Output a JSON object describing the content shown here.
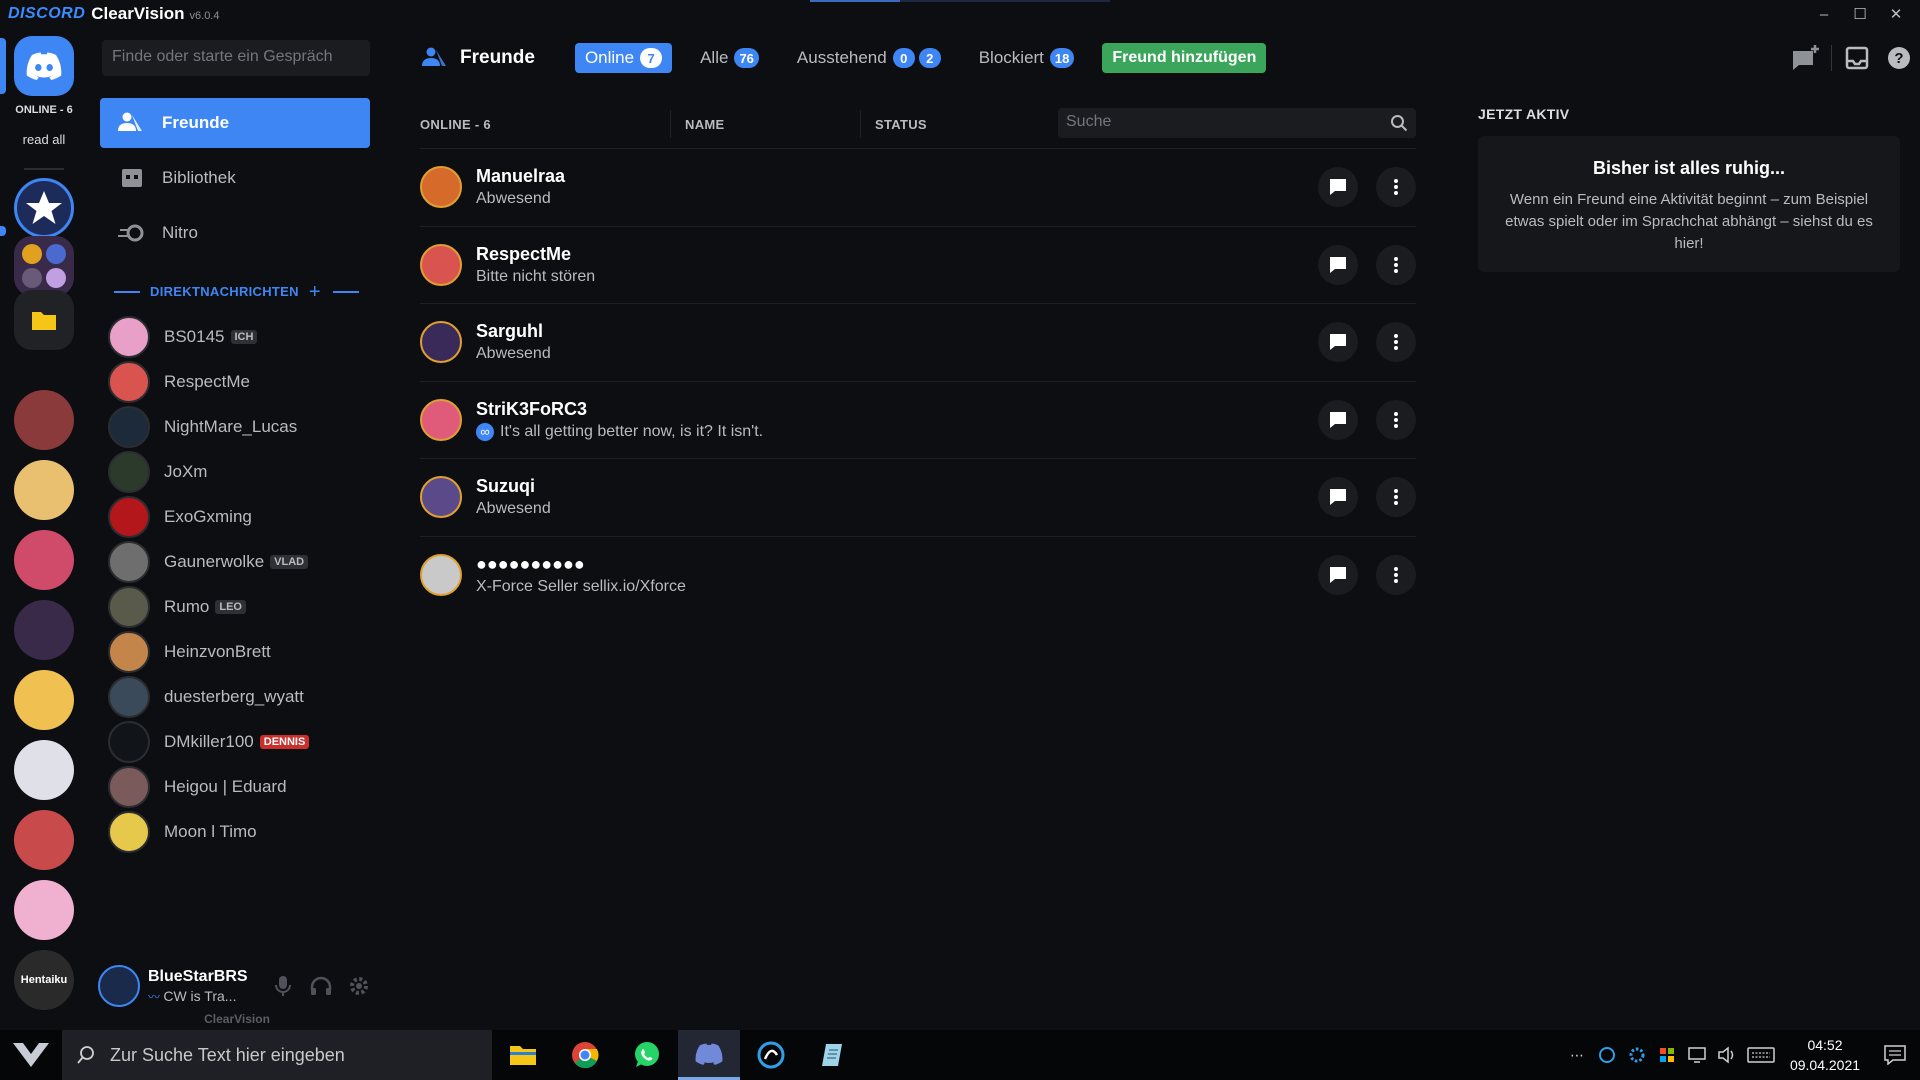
{
  "titlebar": {
    "logo": "DISCORD",
    "app_name": "ClearVision",
    "version": "v6.0.4",
    "minimize": "–",
    "maximize": "☐",
    "close": "✕"
  },
  "guilds": {
    "online_label": "ONLINE - 6",
    "read_all": "read all",
    "bottom_label": "Hentaiku"
  },
  "sidebar": {
    "search_placeholder": "Finde oder starte ein Gespräch",
    "nav": [
      {
        "label": "Freunde",
        "icon": "friends-icon"
      },
      {
        "label": "Bibliothek",
        "icon": "library-icon"
      },
      {
        "label": "Nitro",
        "icon": "nitro-icon"
      }
    ],
    "dm_header": "DIREKTNACHRICHTEN",
    "dm_plus": "+",
    "dms": [
      {
        "name": "BS0145",
        "tag": "ICH",
        "color": "#e8a0c8"
      },
      {
        "name": "RespectMe",
        "tag": "",
        "color": "#d9534f"
      },
      {
        "name": "NightMare_Lucas",
        "tag": "",
        "color": "#1c2a3a"
      },
      {
        "name": "JoXm",
        "tag": "",
        "color": "#2b3a2b"
      },
      {
        "name": "ExoGxming",
        "tag": "",
        "color": "#b3161b"
      },
      {
        "name": "Gaunerwolke",
        "tag": "VLAD",
        "color": "#6e6e6e"
      },
      {
        "name": "Rumo",
        "tag": "LEO",
        "color": "#5a5a4a"
      },
      {
        "name": "HeinzvonBrett",
        "tag": "",
        "color": "#c4854a"
      },
      {
        "name": "duesterberg_wyatt",
        "tag": "",
        "color": "#3a4a5a"
      },
      {
        "name": "DMkiller100",
        "tag": "DENNIS",
        "color": "#111418"
      },
      {
        "name": "Heigou | Eduard",
        "tag": "",
        "color": "#7a5a5a"
      },
      {
        "name": "Moon l Timo",
        "tag": "",
        "color": "#e6c84a"
      }
    ],
    "user": {
      "name": "BlueStarBRS",
      "status": "CW is Tra..."
    },
    "brand": "ClearVision"
  },
  "topbar": {
    "title": "Freunde",
    "tabs": [
      {
        "label": "Online",
        "badge": "7",
        "active": true
      },
      {
        "label": "Alle",
        "badge": "76"
      },
      {
        "label": "Ausstehend",
        "badge": "0",
        "badge2": "2"
      },
      {
        "label": "Blockiert",
        "badge": "18"
      }
    ],
    "add_friend": "Freund hinzufügen"
  },
  "list": {
    "col_online": "ONLINE - 6",
    "col_name": "NAME",
    "col_status": "STATUS",
    "search_placeholder": "Suche",
    "friends": [
      {
        "name": "Manuelraa",
        "status": "Abwesend",
        "color": "#d66a2a"
      },
      {
        "name": "RespectMe",
        "status": "Bitte nicht stören",
        "color": "#d9534f"
      },
      {
        "name": "Sarguhl",
        "status": "Abwesend",
        "color": "#3a2a5a"
      },
      {
        "name": "StriK3FoRC3",
        "status": "It's all getting better now, is it? It isn't.",
        "color": "#e05a7a",
        "status_icon": "infinity-icon"
      },
      {
        "name": "Suzuqi",
        "status": "Abwesend",
        "color": "#5a4a8a"
      },
      {
        "name": "●●●●●●●●●●",
        "status": "X-Force Seller sellix.io/Xforce",
        "color": "#c9c9c9"
      }
    ]
  },
  "active_now": {
    "header": "JETZT AKTIV",
    "title": "Bisher ist alles ruhig...",
    "text": "Wenn ein Freund eine Aktivität beginnt – zum Beispiel etwas spielt oder im Sprachchat abhängt – siehst du es hier!"
  },
  "taskbar": {
    "search_placeholder": "Zur Suche Text hier eingeben",
    "time": "04:52",
    "date": "09.04.2021",
    "overflow": "⋯"
  },
  "colors": {
    "accent": "#3f86f5",
    "add_friend": "#3ba55c"
  }
}
